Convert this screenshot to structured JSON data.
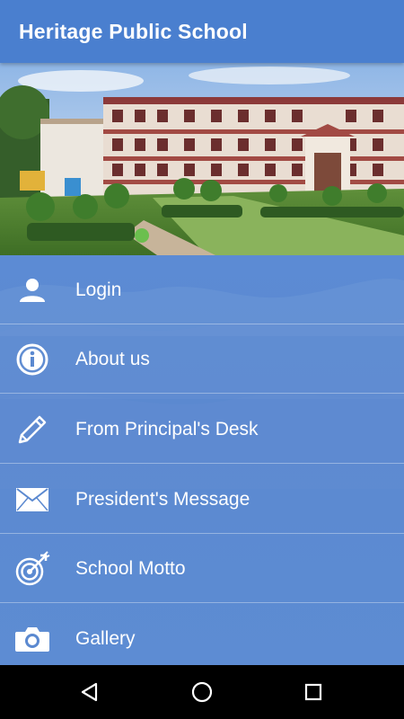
{
  "app": {
    "title": "Heritage Public School"
  },
  "banner": {
    "image": "school-building-photo"
  },
  "menu": {
    "items": [
      {
        "label": "Login",
        "icon": "user-icon"
      },
      {
        "label": "About us",
        "icon": "info-icon"
      },
      {
        "label": "From Principal's Desk",
        "icon": "pencil-icon"
      },
      {
        "label": "President's Message",
        "icon": "envelope-icon"
      },
      {
        "label": "School Motto",
        "icon": "target-icon"
      },
      {
        "label": "Gallery",
        "icon": "camera-icon"
      }
    ]
  },
  "navbar": {
    "buttons": [
      "back-icon",
      "home-icon",
      "recents-icon"
    ]
  },
  "colors": {
    "appbar": "#4a7fcf",
    "menu_background": "#5b89d0",
    "text": "#ffffff",
    "navbar": "#000000"
  }
}
